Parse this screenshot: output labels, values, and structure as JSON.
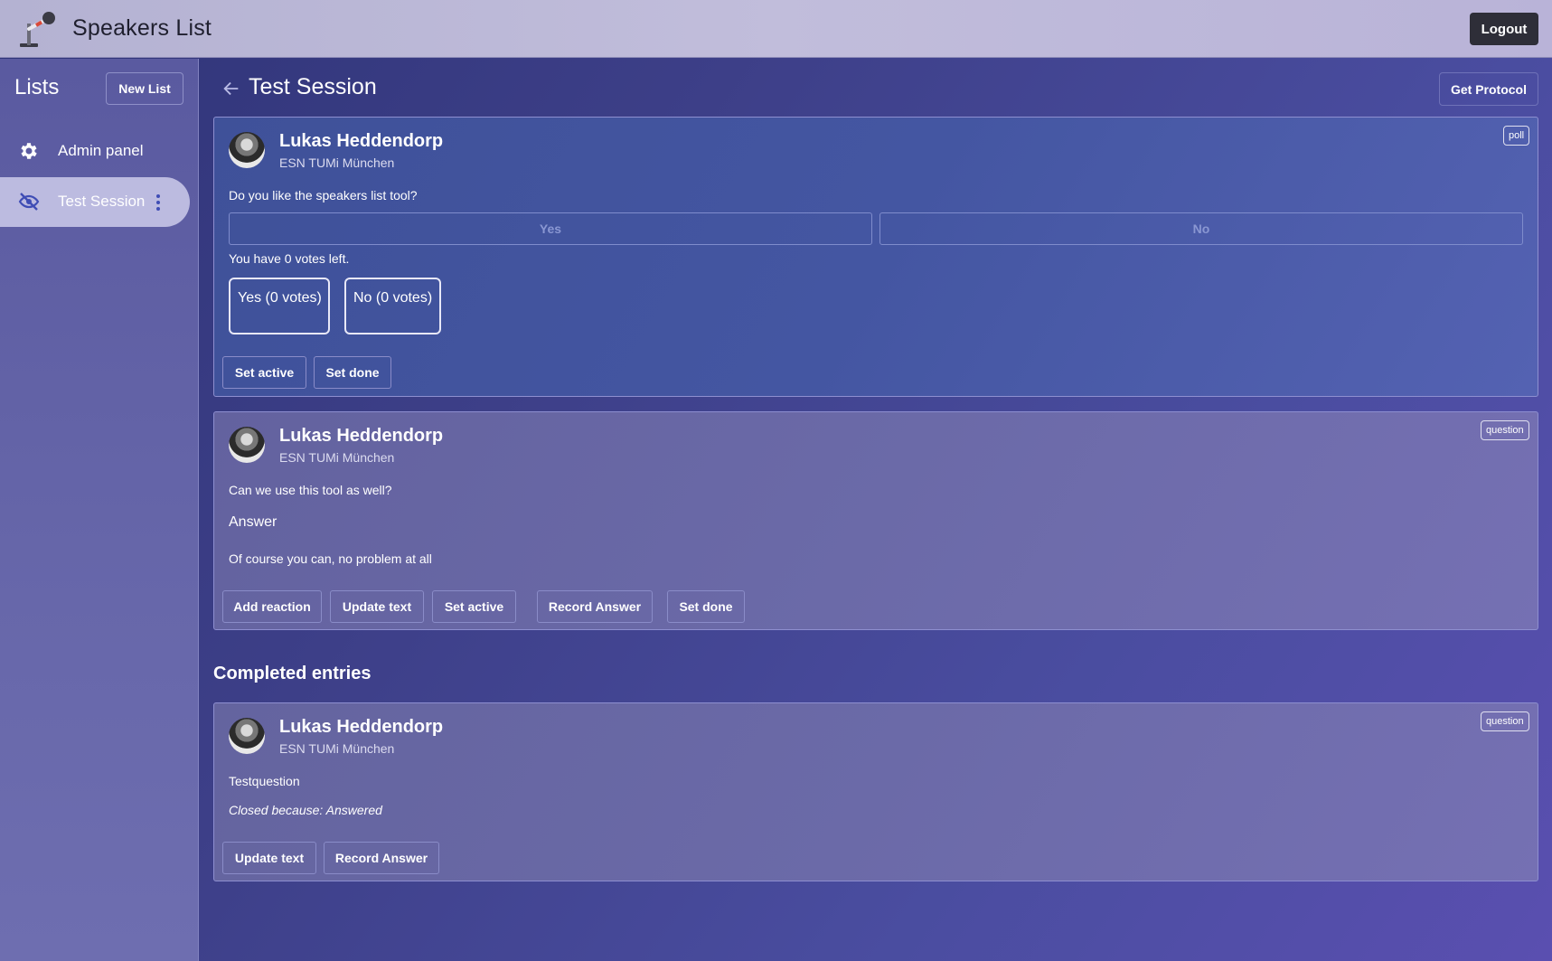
{
  "app": {
    "title": "Speakers List",
    "logout_label": "Logout"
  },
  "sidebar": {
    "title": "Lists",
    "new_list_label": "New List",
    "items": [
      {
        "label": "Admin panel",
        "icon": "gear-icon"
      },
      {
        "label": "Test Session",
        "icon": "eye-off-icon"
      }
    ]
  },
  "main": {
    "title": "Test Session",
    "protocol_label": "Get Protocol",
    "completed_title": "Completed entries"
  },
  "entries": [
    {
      "type_tag": "poll",
      "author": "Lukas Heddendorp",
      "org": "ESN TUMi München",
      "text": "Do you like the speakers list tool?",
      "options": [
        "Yes",
        "No"
      ],
      "votes_left": "You have 0 votes left.",
      "results": [
        "Yes (0 votes)",
        "No (0 votes)"
      ],
      "actions": [
        "Set active",
        "Set done"
      ]
    },
    {
      "type_tag": "question",
      "author": "Lukas Heddendorp",
      "org": "ESN TUMi München",
      "text": "Can we use this tool as well?",
      "answer_heading": "Answer",
      "answer": "Of course you can, no problem at all",
      "actions": [
        "Add reaction",
        "Update text",
        "Set active",
        "Record Answer",
        "Set done"
      ]
    }
  ],
  "completed": [
    {
      "type_tag": "question",
      "author": "Lukas Heddendorp",
      "org": "ESN TUMi München",
      "text": "Testquestion",
      "closed_reason": "Closed because: Answered",
      "actions": [
        "Update text",
        "Record Answer"
      ]
    }
  ]
}
